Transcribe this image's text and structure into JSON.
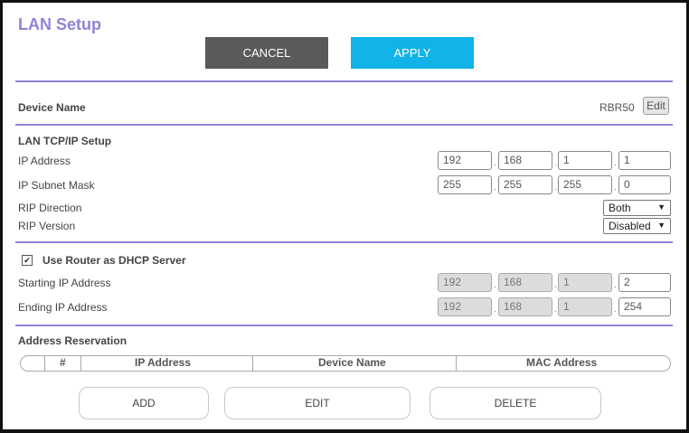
{
  "page": {
    "title": "LAN Setup"
  },
  "toolbar": {
    "cancel_label": "CANCEL",
    "apply_label": "APPLY"
  },
  "device": {
    "label": "Device Name",
    "value": "RBR50",
    "edit_label": "Edit"
  },
  "lan": {
    "section_title": "LAN TCP/IP Setup",
    "ip_label": "IP Address",
    "ip": [
      "192",
      "168",
      "1",
      "1"
    ],
    "mask_label": "IP Subnet Mask",
    "mask": [
      "255",
      "255",
      "255",
      "0"
    ],
    "rip_direction_label": "RIP Direction",
    "rip_direction_value": "Both",
    "rip_version_label": "RIP Version",
    "rip_version_value": "Disabled"
  },
  "dhcp": {
    "checkbox_label": "Use Router as DHCP Server",
    "checked": true,
    "start_label": "Starting IP Address",
    "start": [
      "192",
      "168",
      "1",
      "2"
    ],
    "end_label": "Ending IP Address",
    "end": [
      "192",
      "168",
      "1",
      "254"
    ]
  },
  "reservation": {
    "section_title": "Address Reservation",
    "columns": [
      "#",
      "IP Address",
      "Device Name",
      "MAC Address"
    ],
    "add_label": "ADD",
    "edit_label": "EDIT",
    "delete_label": "DELETE"
  },
  "colors": {
    "accent": "#8c84d6",
    "apply": "#12b3e8",
    "cancel": "#5a5a5a"
  }
}
